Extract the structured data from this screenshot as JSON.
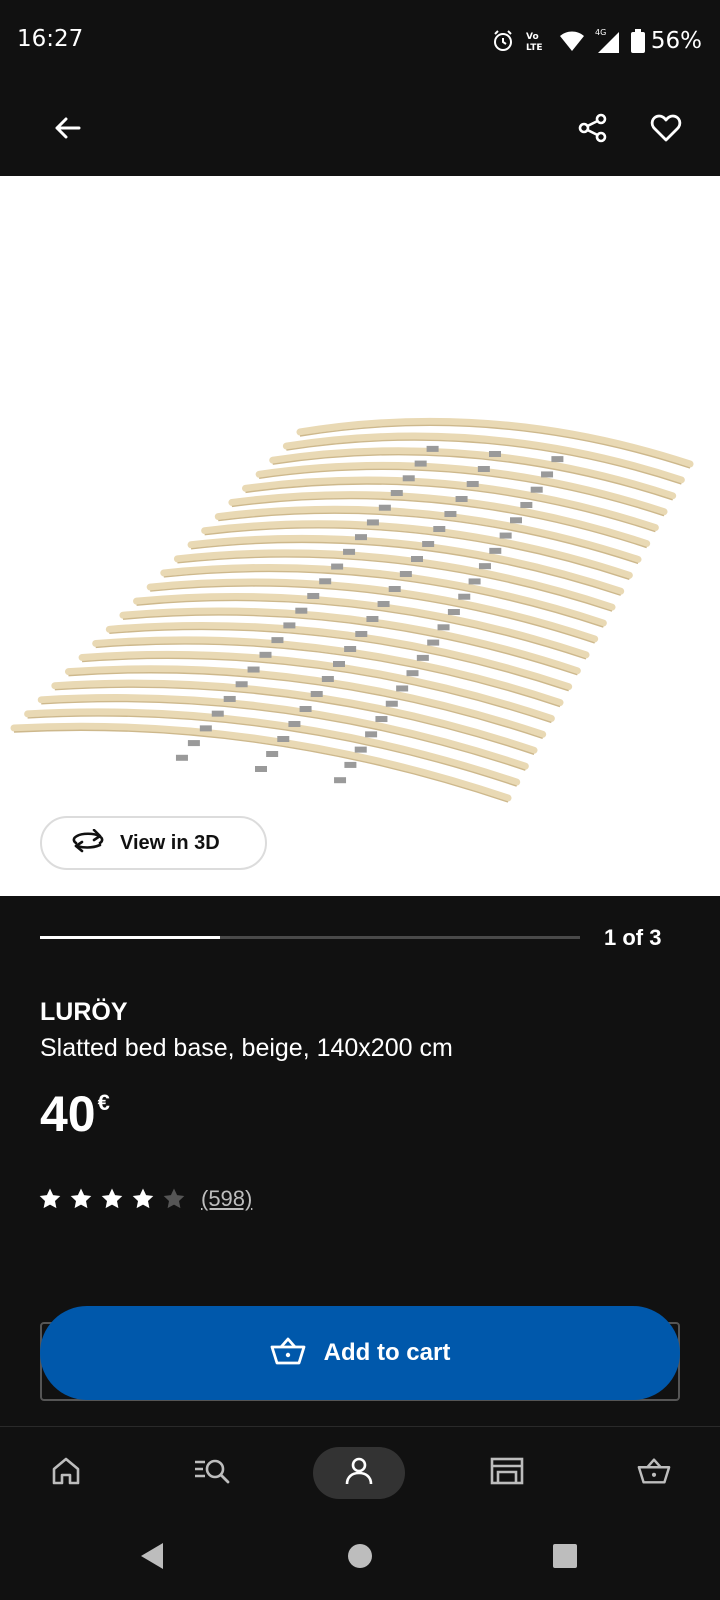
{
  "status_bar": {
    "time": "16:27",
    "battery": "56%",
    "icons": [
      "alarm-icon",
      "volte-icon",
      "wifi-icon",
      "signal-4g-icon",
      "battery-icon"
    ]
  },
  "top_bar": {
    "icons": [
      "arrow-back-icon",
      "share-icon",
      "heart-icon"
    ]
  },
  "gallery": {
    "view_3d_label": "View in 3D",
    "page_indicator": "1 of 3",
    "progress": {
      "current": 1,
      "total": 3
    }
  },
  "product": {
    "name": "LURÖY",
    "description": "Slatted bed base, beige, 140x200 cm",
    "price": "40",
    "currency": "€",
    "rating": {
      "stars": 4,
      "max": 5,
      "count_label": "(598)"
    }
  },
  "actions": {
    "add_to_cart_label": "Add to cart"
  },
  "bottom_nav": {
    "items": [
      "home-icon",
      "search-list-icon",
      "profile-icon",
      "store-icon",
      "basket-icon"
    ],
    "active": "profile-icon"
  },
  "colors": {
    "background": "#111111",
    "accent_blue": "#0058ab",
    "image_background": "#ffffff"
  }
}
